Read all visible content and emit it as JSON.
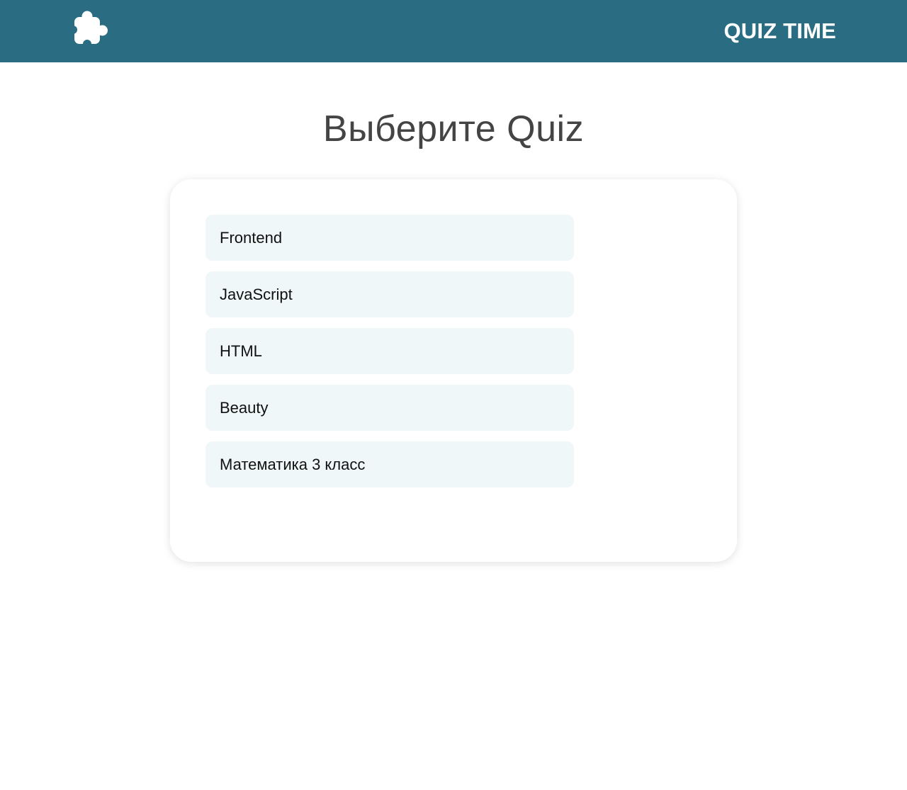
{
  "header": {
    "logo_icon": "puzzle-piece-icon",
    "brand": "QUIZ TIME",
    "background_color": "#2a6d83"
  },
  "main": {
    "title": "Выберите Quiz",
    "quizzes": [
      {
        "label": "Frontend"
      },
      {
        "label": "JavaScript"
      },
      {
        "label": "HTML"
      },
      {
        "label": "Beauty"
      },
      {
        "label": "Математика 3 класс"
      }
    ]
  }
}
